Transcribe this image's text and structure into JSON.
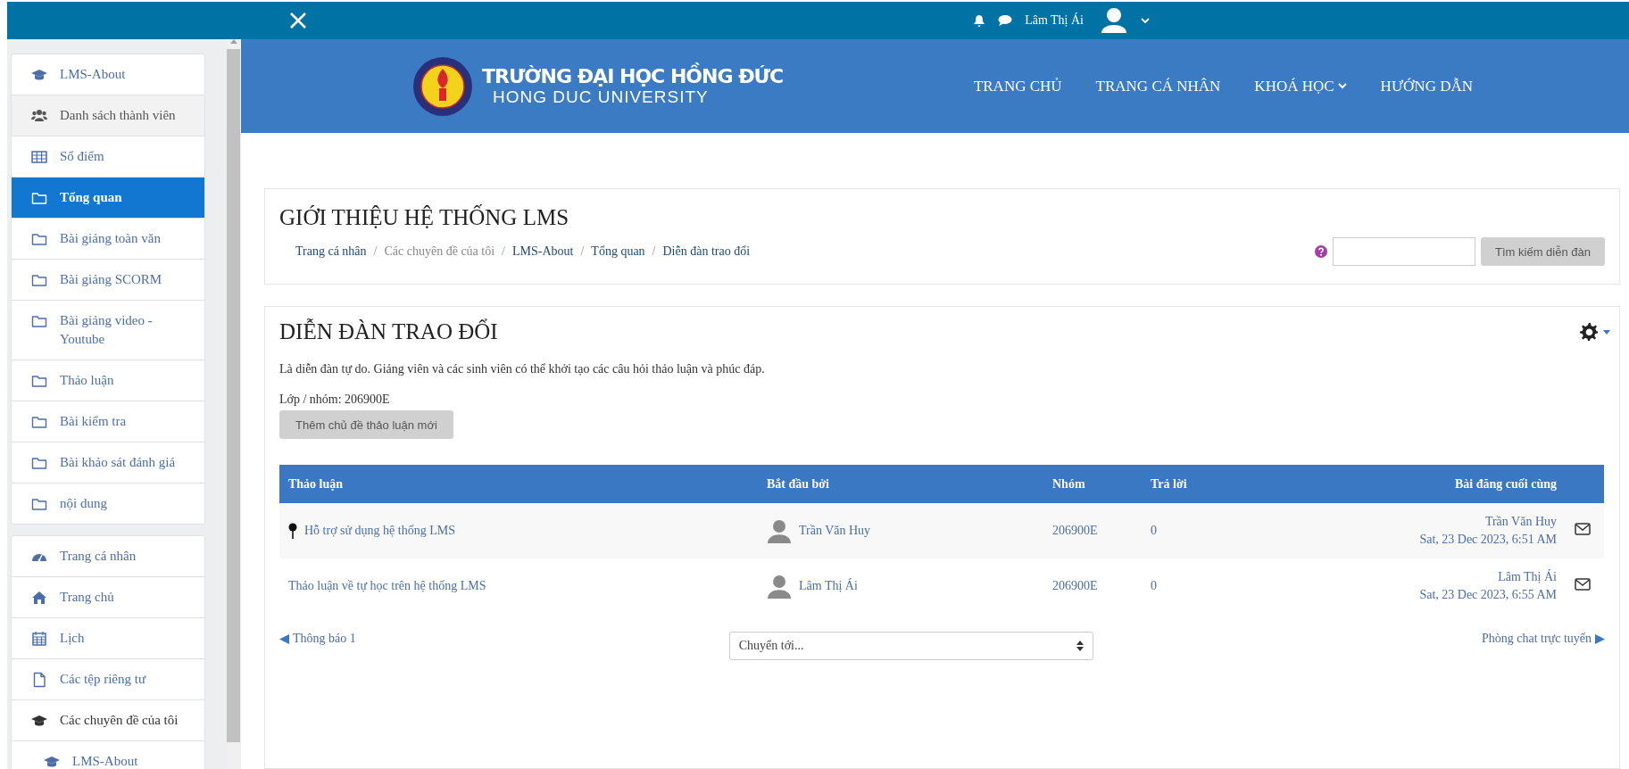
{
  "topbar": {
    "user_name": "Lâm Thị Ái"
  },
  "sidebar": {
    "sections": [
      {
        "items": [
          {
            "label": "LMS-About",
            "kind": "course",
            "selected": false,
            "highlighted": false
          },
          {
            "label": "Danh sách thành viên",
            "kind": "participants",
            "selected": false,
            "highlighted": true
          },
          {
            "label": "Sổ điểm",
            "kind": "grades",
            "selected": false,
            "highlighted": false
          },
          {
            "label": "Tổng quan",
            "kind": "section",
            "selected": true,
            "highlighted": false
          },
          {
            "label": "Bài giảng toàn văn",
            "kind": "section",
            "selected": false,
            "highlighted": false
          },
          {
            "label": "Bài giảng SCORM",
            "kind": "section",
            "selected": false,
            "highlighted": false
          },
          {
            "label": "Bài giảng video - Youtube",
            "kind": "section",
            "selected": false,
            "highlighted": false
          },
          {
            "label": "Thảo luận",
            "kind": "section",
            "selected": false,
            "highlighted": false
          },
          {
            "label": "Bài kiểm tra",
            "kind": "section",
            "selected": false,
            "highlighted": false
          },
          {
            "label": "Bài khảo sát đánh giá",
            "kind": "section",
            "selected": false,
            "highlighted": false
          },
          {
            "label": "nội dung",
            "kind": "section",
            "selected": false,
            "highlighted": false
          }
        ]
      },
      {
        "items": [
          {
            "label": "Trang cá nhân",
            "kind": "dashboard",
            "selected": false,
            "highlighted": false
          },
          {
            "label": "Trang chủ",
            "kind": "home",
            "selected": false,
            "highlighted": false
          },
          {
            "label": "Lịch",
            "kind": "calendar",
            "selected": false,
            "highlighted": false
          },
          {
            "label": "Các tệp riêng tư",
            "kind": "files",
            "selected": false,
            "highlighted": false
          },
          {
            "label": "Các chuyên đề của tôi",
            "kind": "category",
            "selected": false,
            "highlighted": false,
            "children": [
              {
                "label": "LMS-About",
                "kind": "course",
                "selected": false,
                "highlighted": false
              }
            ]
          }
        ]
      }
    ]
  },
  "header": {
    "title": "TRƯỜNG ĐẠI HỌC HỒNG ĐỨC",
    "subtitle": "HONG DUC UNIVERSITY",
    "nav": [
      {
        "label": "TRANG CHỦ",
        "has_menu": false
      },
      {
        "label": "TRANG CÁ NHÂN",
        "has_menu": false
      },
      {
        "label": "KHOÁ HỌC",
        "has_menu": true
      },
      {
        "label": "HƯỚNG DẪN",
        "has_menu": false
      }
    ]
  },
  "page_header": {
    "title": "GIỚI THIỆU HỆ THỐNG LMS",
    "breadcrumbs": [
      {
        "label": "Trang cá nhân",
        "link": true
      },
      {
        "label": "Các chuyên đề của tôi",
        "link": false
      },
      {
        "label": "LMS-About",
        "link": true
      },
      {
        "label": "Tổng quan",
        "link": true
      },
      {
        "label": "Diễn đàn trao đổi",
        "link": true
      }
    ],
    "separator": "/",
    "search_button": "Tìm kiếm diễn đàn"
  },
  "forum": {
    "title": "DIỄN ĐÀN TRAO ĐỔI",
    "description": "Là diễn đàn tự do. Giảng viên và các sinh viên có thể khởi tạo các câu hỏi thảo luận và phúc đáp.",
    "group_label": "Lớp / nhóm: 206900E",
    "add_button": "Thêm chủ đề thảo luận mới",
    "table": {
      "columns": [
        "Thảo luận",
        "Bắt đầu bởi",
        "Nhóm",
        "Trả lời",
        "Bài đăng cuối cùng"
      ],
      "rows": [
        {
          "title": "Hỗ trợ sử dụng hệ thống LMS",
          "pinned": true,
          "starter": "Trần Văn Huy",
          "group": "206900E",
          "replies": "0",
          "last_post_by": "Trần Văn Huy",
          "last_post_date": "Sat, 23 Dec 2023, 6:51 AM"
        },
        {
          "title": "Thảo luận về tự học trên hệ thống LMS",
          "pinned": false,
          "starter": "Lâm Thị Ái",
          "group": "206900E",
          "replies": "0",
          "last_post_by": "Lâm Thị Ái",
          "last_post_date": "Sat, 23 Dec 2023, 6:55 AM"
        }
      ]
    },
    "prev_link": "Thông báo 1",
    "jump_select": "Chuyển tới...",
    "next_link": "Phòng chat trực tuyến"
  }
}
